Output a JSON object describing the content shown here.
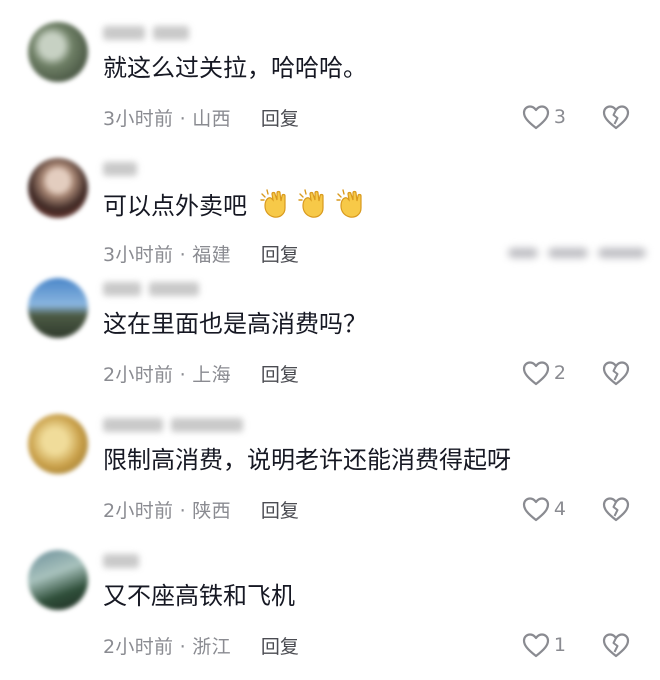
{
  "comments": [
    {
      "text": "就这么过关拉，哈哈哈。",
      "time_location": "3小时前 · 山西",
      "reply_label": "回复",
      "like_count": "3",
      "avatar_colors": [
        "#5a6b50",
        "#c7d1c3"
      ]
    },
    {
      "text": "可以点外卖吧",
      "time_location": "3小时前 · 福建",
      "reply_label": "回复",
      "emoji_icons": [
        "clapping-hands-icon",
        "clapping-hands-icon",
        "clapping-hands-icon"
      ],
      "avatar_colors": [
        "#3f2a26",
        "#d9c3b5"
      ]
    },
    {
      "text": "这在里面也是高消费吗？",
      "time_location": "2小时前 · 上海",
      "reply_label": "回复",
      "like_count": "2",
      "avatar_colors": [
        "#4a7fc1",
        "#3b4a3a"
      ]
    },
    {
      "text": "限制高消费，说明老许还能消费得起呀",
      "time_location": "2小时前 · 陕西",
      "reply_label": "回复",
      "like_count": "4",
      "avatar_colors": [
        "#c9a04a",
        "#e8d08a"
      ]
    },
    {
      "text": "又不座高铁和飞机",
      "time_location": "2小时前 · 浙江",
      "reply_label": "回复",
      "like_count": "1",
      "avatar_colors": [
        "#2f4f6a",
        "#8fa7a0"
      ]
    }
  ],
  "colors": {
    "text": "#161823",
    "meta": "#8a8b91",
    "reply": "#4b4c52",
    "icon": "#8a8b91",
    "clap": "#f7c948"
  }
}
